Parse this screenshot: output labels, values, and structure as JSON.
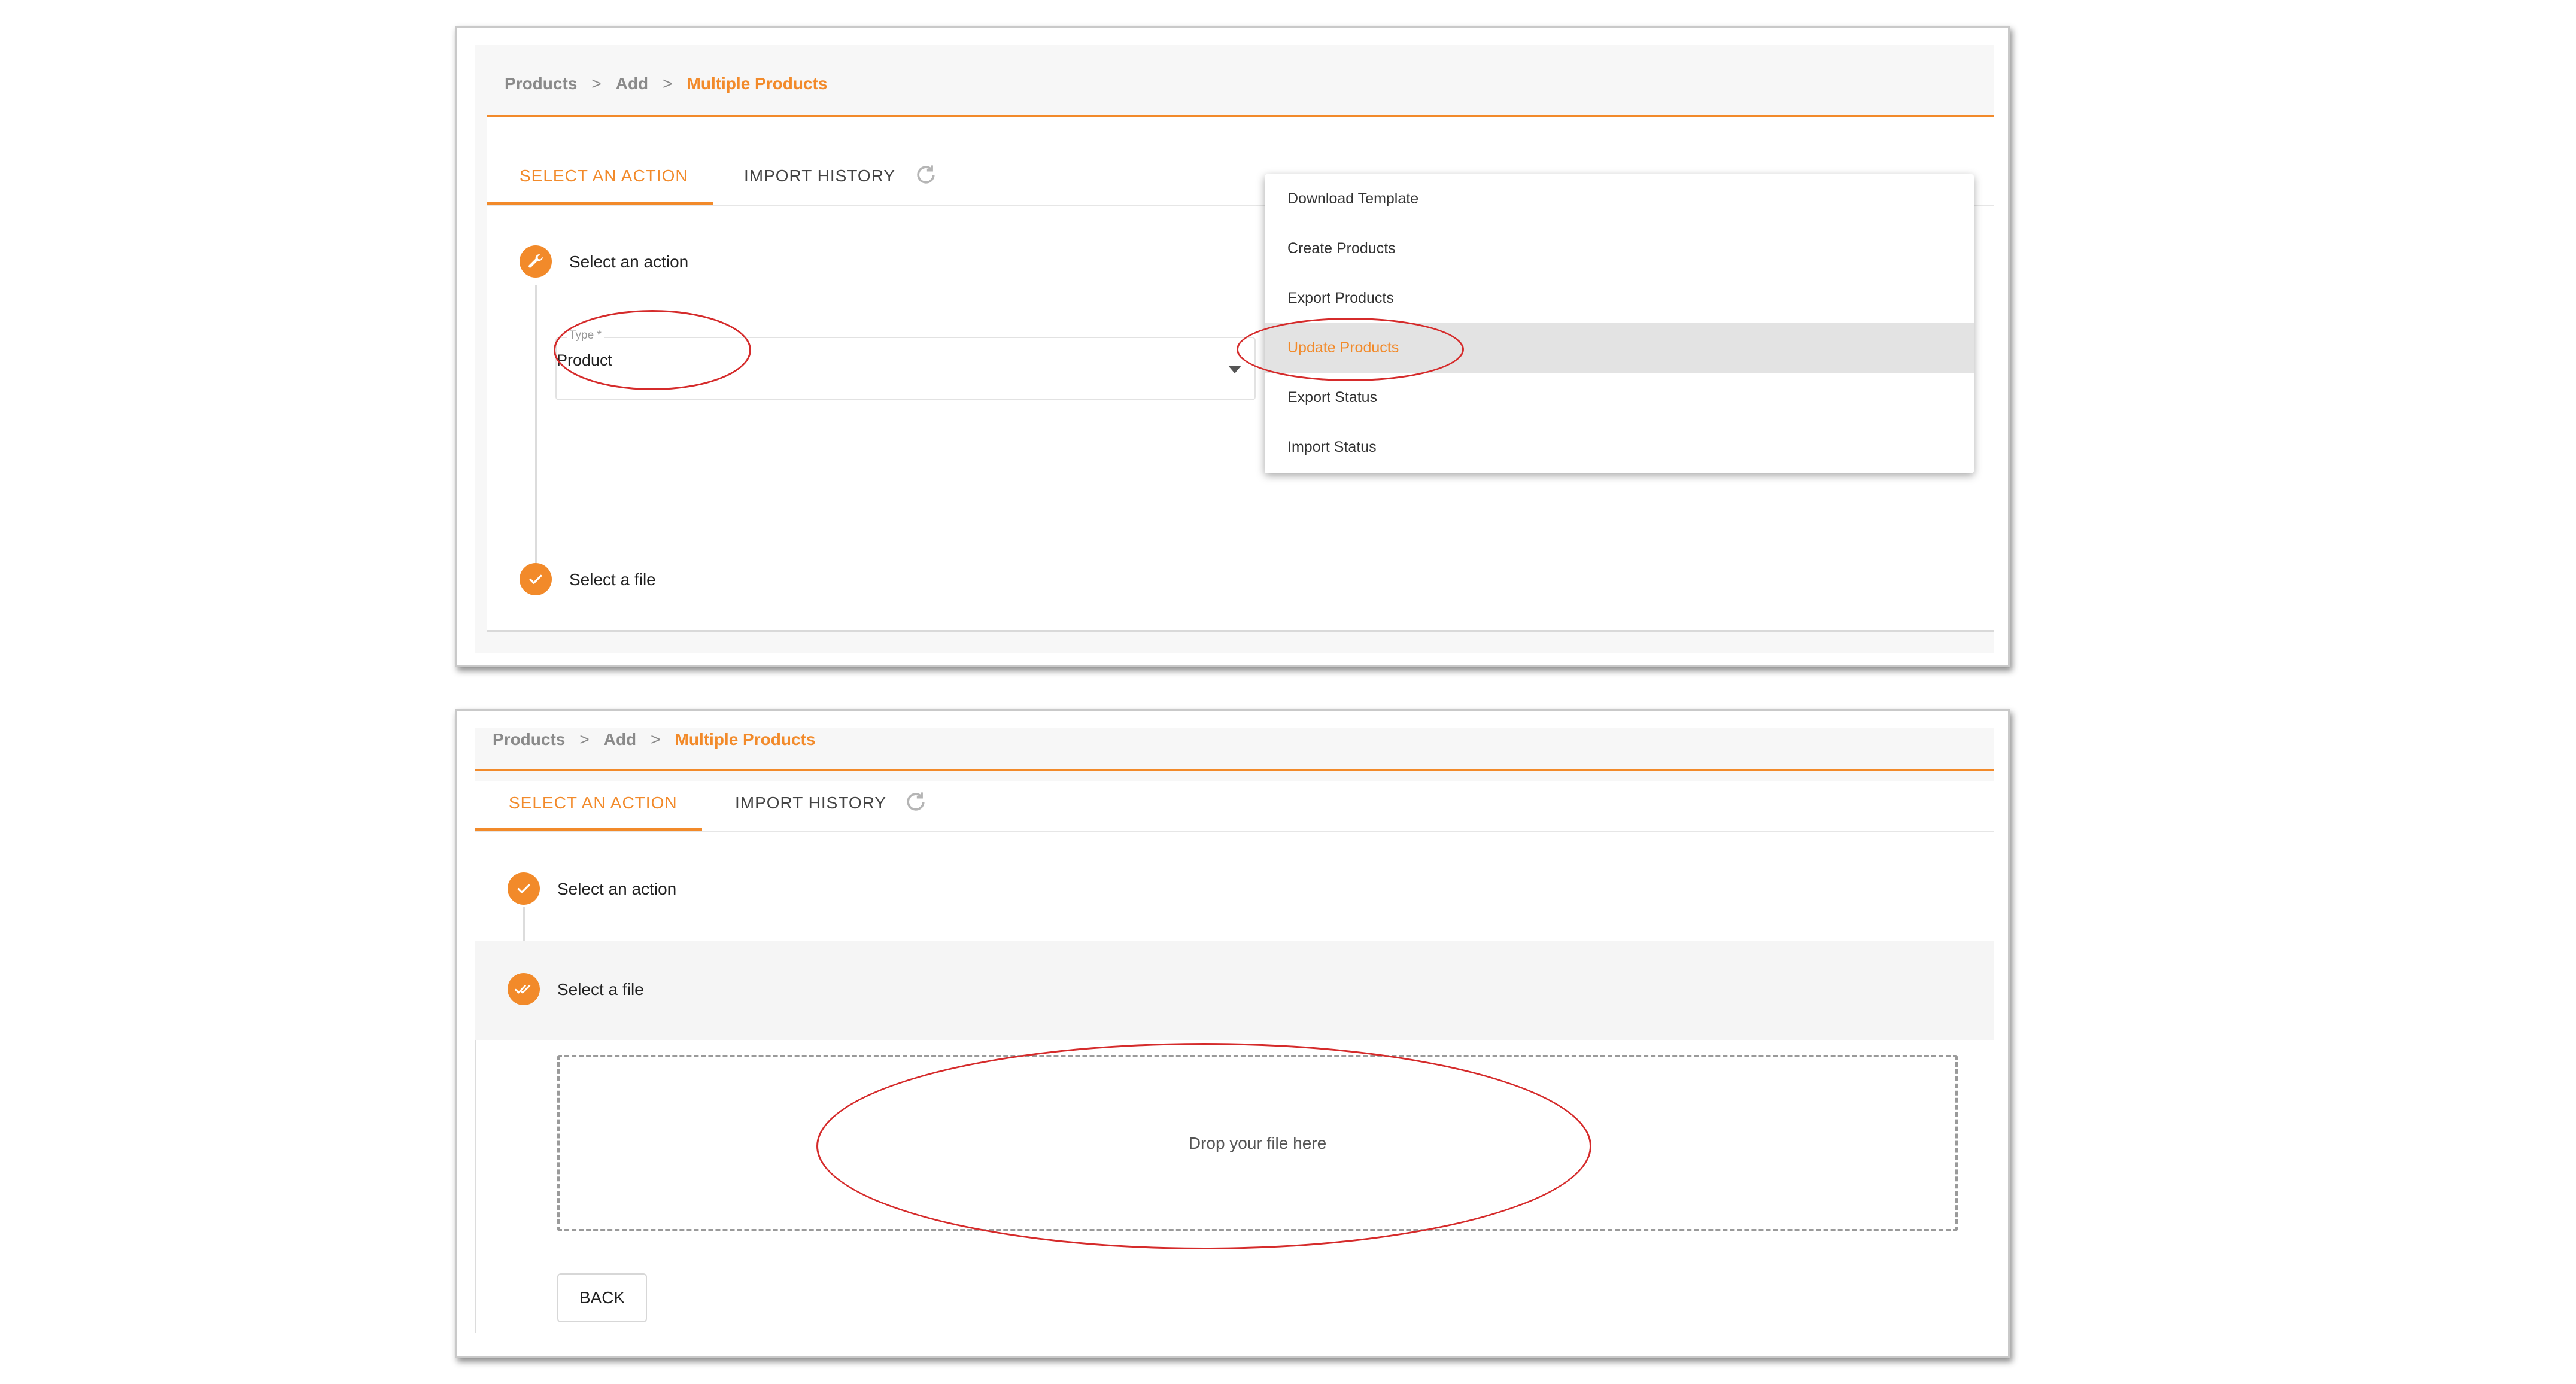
{
  "panel_top": {
    "breadcrumb": {
      "items": [
        "Products",
        "Add"
      ],
      "separator": ">",
      "current": "Multiple Products"
    },
    "tabs": [
      {
        "label": "SELECT AN ACTION",
        "active": true
      },
      {
        "label": "IMPORT HISTORY",
        "active": false
      }
    ],
    "refresh_icon": "refresh-icon",
    "step1": {
      "label": "Select an action",
      "icon": "wrench-icon"
    },
    "type_field": {
      "label": "Type *",
      "value": "Product"
    },
    "dropdown": {
      "items": [
        "Download Template",
        "Create Products",
        "Export Products",
        "Update Products",
        "Export Status",
        "Import Status"
      ],
      "selected": "Update Products"
    },
    "step2": {
      "label": "Select a file",
      "icon": "check-icon"
    }
  },
  "panel_bottom": {
    "breadcrumb": {
      "items": [
        "Products",
        "Add"
      ],
      "separator": ">",
      "current": "Multiple Products"
    },
    "tabs": [
      {
        "label": "SELECT AN ACTION",
        "active": true
      },
      {
        "label": "IMPORT HISTORY",
        "active": false
      }
    ],
    "refresh_icon": "refresh-icon",
    "step1": {
      "label": "Select an action",
      "icon": "check-icon"
    },
    "step2": {
      "label": "Select a file",
      "icon": "double-check-icon"
    },
    "dropzone": {
      "text": "Drop your file here"
    },
    "back_button": {
      "label": "BACK"
    }
  },
  "colors": {
    "accent": "#f28a2a",
    "annotation": "#d52b2b",
    "selected_bg": "#e3e3e3"
  }
}
